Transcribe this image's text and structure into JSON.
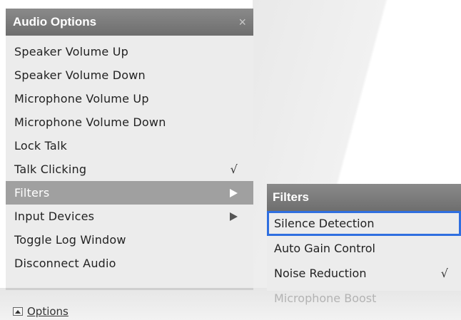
{
  "audio_options": {
    "title": "Audio Options",
    "close_symbol": "×",
    "items": [
      {
        "label": "Speaker Volume Up"
      },
      {
        "label": "Speaker Volume Down"
      },
      {
        "label": "Microphone Volume Up"
      },
      {
        "label": "Microphone Volume Down"
      },
      {
        "label": "Lock Talk"
      },
      {
        "label": "Talk Clicking",
        "check": "√"
      },
      {
        "label": "Filters"
      },
      {
        "label": "Input Devices"
      },
      {
        "label": "Toggle Log Window"
      },
      {
        "label": "Disconnect Audio"
      }
    ]
  },
  "footer": {
    "options_label": "Options"
  },
  "filters_submenu": {
    "title": "Filters",
    "items": [
      {
        "label": "Silence Detection"
      },
      {
        "label": "Auto Gain Control"
      },
      {
        "label": "Noise Reduction",
        "check": "√"
      },
      {
        "label": "Microphone Boost"
      }
    ]
  },
  "colors": {
    "header": "#7c7c7c",
    "active_item": "#a0a0a0",
    "focus_ring": "#2f6fe0",
    "disabled_text": "#b3b3b3"
  }
}
